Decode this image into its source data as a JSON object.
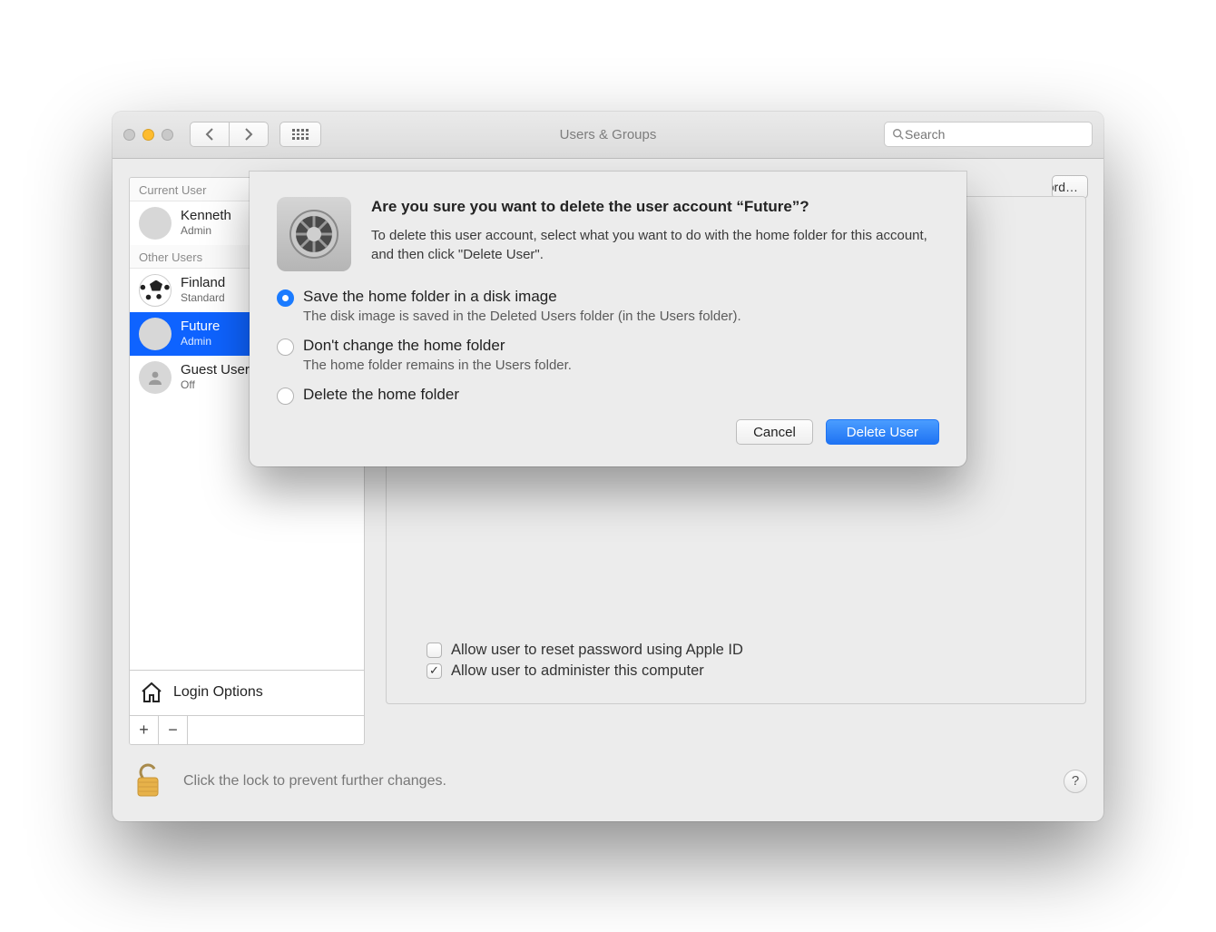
{
  "window": {
    "title": "Users & Groups",
    "search_placeholder": "Search"
  },
  "sidebar": {
    "section_current": "Current User",
    "section_other": "Other Users",
    "users": [
      {
        "name": "Kenneth",
        "sub": "Admin",
        "selected": false,
        "avatar": "kenn"
      },
      {
        "name": "Finland",
        "sub": "Standard",
        "selected": false,
        "avatar": "soccer"
      },
      {
        "name": "Future",
        "sub": "Admin",
        "selected": true,
        "avatar": "flower"
      },
      {
        "name": "Guest User",
        "sub": "Off",
        "selected": false,
        "avatar": "guest"
      }
    ],
    "login_options": "Login Options"
  },
  "pane": {
    "change_password": "Change Password…",
    "check_reset_label": "Allow user to reset password using Apple ID",
    "check_reset_checked": false,
    "check_admin_label": "Allow user to administer this computer",
    "check_admin_checked": true
  },
  "footer": {
    "text": "Click the lock to prevent further changes."
  },
  "modal": {
    "title": "Are you sure you want to delete the user account “Future”?",
    "subtitle": "To delete this user account, select what you want to do with the home folder for this account, and then click \"Delete User\".",
    "options": [
      {
        "label": "Save the home folder in a disk image",
        "desc": "The disk image is saved in the Deleted Users folder (in the Users folder).",
        "selected": true
      },
      {
        "label": "Don't change the home folder",
        "desc": "The home folder remains in the Users folder.",
        "selected": false
      },
      {
        "label": "Delete the home folder",
        "desc": "",
        "selected": false
      }
    ],
    "cancel": "Cancel",
    "confirm": "Delete User"
  }
}
